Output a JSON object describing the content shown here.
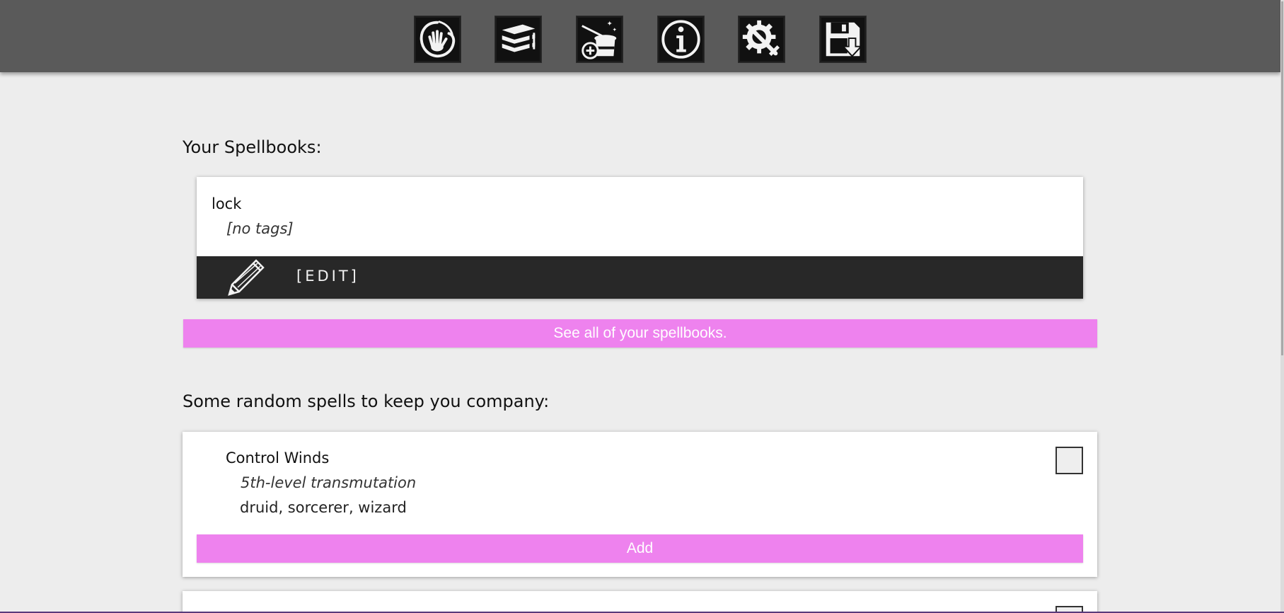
{
  "nav": {
    "items": [
      {
        "name": "hand-icon"
      },
      {
        "name": "spellbooks-icon"
      },
      {
        "name": "magic-hat-add-icon"
      },
      {
        "name": "info-icon"
      },
      {
        "name": "settings-icon"
      },
      {
        "name": "save-icon"
      }
    ]
  },
  "spellbooks": {
    "heading": "Your Spellbooks:",
    "books": [
      {
        "name": "lock",
        "tags": "[no tags]",
        "edit_label": "[EDIT]"
      }
    ],
    "see_all_label": "See all of your spellbooks."
  },
  "random_spells": {
    "heading": "Some random spells to keep you company:",
    "spells": [
      {
        "name": "Control Winds",
        "level": "5th-level transmutation",
        "classes": "druid, sorcerer, wizard",
        "add_label": "Add"
      }
    ]
  },
  "colors": {
    "accent": "#ee82ee",
    "topbar": "#5a5a5a",
    "edit_bar": "#282828",
    "background": "#ededed"
  }
}
